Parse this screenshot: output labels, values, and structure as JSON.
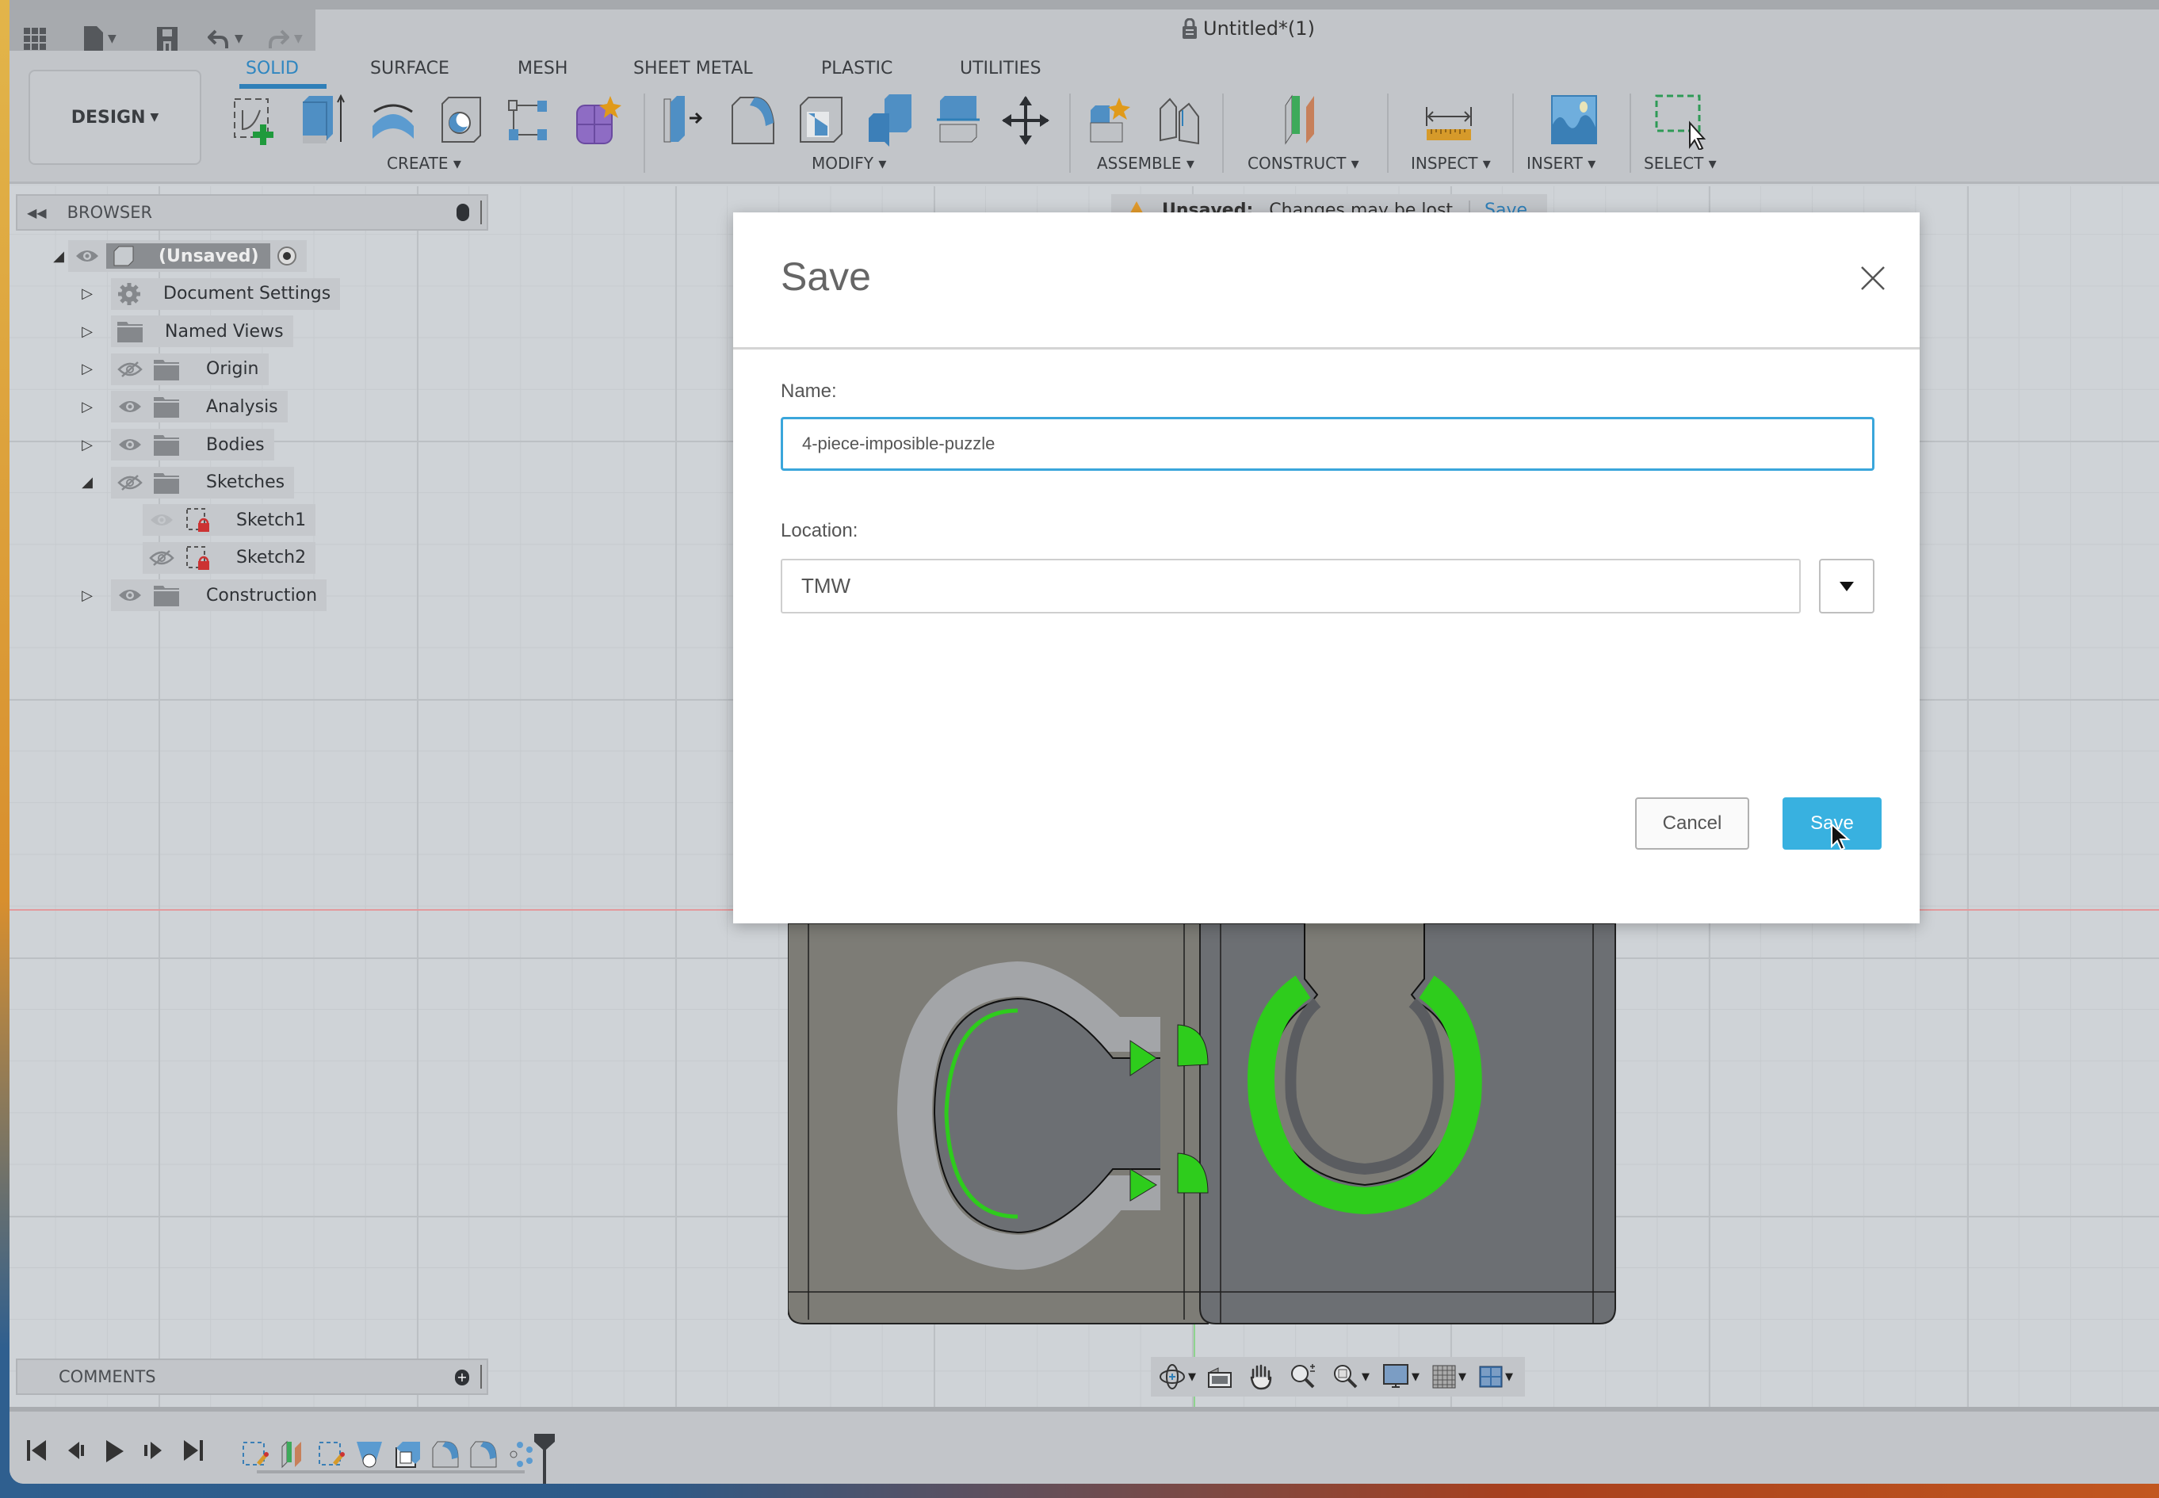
{
  "window": {
    "title": "Untitled*(1)",
    "title_icon": "lock-icon"
  },
  "quick_access": [
    {
      "name": "apps-grid-icon"
    },
    {
      "name": "file-icon",
      "has_caret": true
    },
    {
      "name": "save-icon"
    },
    {
      "name": "undo-icon",
      "has_caret": true
    },
    {
      "name": "redo-icon",
      "has_caret": true
    }
  ],
  "workspace": {
    "label": "DESIGN",
    "caret": "▾"
  },
  "tabs": [
    {
      "label": "SOLID",
      "active": true
    },
    {
      "label": "SURFACE",
      "active": false
    },
    {
      "label": "MESH",
      "active": false
    },
    {
      "label": "SHEET METAL",
      "active": false
    },
    {
      "label": "PLASTIC",
      "active": false
    },
    {
      "label": "UTILITIES",
      "active": false
    }
  ],
  "toolbar_groups": [
    {
      "label": "CREATE ▾",
      "tools": [
        "create-sketch-icon",
        "extrude-icon",
        "revolve-icon",
        "hole-icon",
        "pattern-icon",
        "create-form-icon"
      ]
    },
    {
      "label": "MODIFY ▾",
      "tools": [
        "press-pull-icon",
        "fillet-icon",
        "shell-icon",
        "combine-icon",
        "split-body-icon",
        "move-icon"
      ]
    },
    {
      "label": "ASSEMBLE ▾",
      "tools": [
        "new-component-icon",
        "joint-icon"
      ]
    },
    {
      "label": "CONSTRUCT ▾",
      "tools": [
        "offset-plane-icon"
      ]
    },
    {
      "label": "INSPECT ▾",
      "tools": [
        "measure-icon"
      ]
    },
    {
      "label": "INSERT ▾",
      "tools": [
        "insert-image-icon"
      ]
    },
    {
      "label": "SELECT ▾",
      "tools": [
        "select-window-icon"
      ]
    }
  ],
  "browser": {
    "title": "BROWSER",
    "root": {
      "label": "(Unsaved)",
      "expanded": true,
      "visible": true
    },
    "items": [
      {
        "label": "Document Settings",
        "icon": "gear-icon",
        "expanded": false,
        "eye": null,
        "level": 1
      },
      {
        "label": "Named Views",
        "icon": "folder-icon",
        "expanded": false,
        "eye": null,
        "level": 1
      },
      {
        "label": "Origin",
        "icon": "folder-icon",
        "expanded": false,
        "eye": "hidden",
        "level": 1
      },
      {
        "label": "Analysis",
        "icon": "folder-icon",
        "expanded": false,
        "eye": "visible",
        "level": 1
      },
      {
        "label": "Bodies",
        "icon": "folder-icon",
        "expanded": false,
        "eye": "visible",
        "level": 1
      },
      {
        "label": "Sketches",
        "icon": "folder-icon",
        "expanded": true,
        "eye": "hidden",
        "level": 1
      },
      {
        "label": "Sketch1",
        "icon": "sketch-icon",
        "expanded": null,
        "eye": "faded",
        "level": 2
      },
      {
        "label": "Sketch2",
        "icon": "sketch-icon",
        "expanded": null,
        "eye": "hidden",
        "level": 2
      },
      {
        "label": "Construction",
        "icon": "folder-icon",
        "expanded": false,
        "eye": "visible",
        "level": 1
      }
    ]
  },
  "banner": {
    "label": "Unsaved:",
    "message": "Changes may be lost",
    "action": "Save"
  },
  "dialog": {
    "title": "Save",
    "name_label": "Name:",
    "name_value": "4-piece-imposible-puzzle",
    "location_label": "Location:",
    "location_value": "TMW",
    "cancel_label": "Cancel",
    "save_label": "Save"
  },
  "comments": {
    "title": "COMMENTS"
  },
  "nav_bar": [
    {
      "name": "orbit-icon",
      "caret": true
    },
    {
      "name": "look-at-icon",
      "caret": false
    },
    {
      "name": "pan-icon",
      "caret": false
    },
    {
      "name": "zoom-icon",
      "caret": false
    },
    {
      "name": "fit-icon",
      "caret": true
    },
    {
      "name": "display-settings-icon",
      "caret": true
    },
    {
      "name": "grid-settings-icon",
      "caret": true
    },
    {
      "name": "viewports-icon",
      "caret": true
    }
  ],
  "timeline": {
    "controls": [
      "go-to-start-icon",
      "step-back-icon",
      "play-icon",
      "step-forward-icon",
      "go-to-end-icon"
    ],
    "features": [
      "sketch-feature-icon",
      "plane-feature-icon",
      "sketch-feature-icon",
      "revolve-feature-icon",
      "shell-feature-icon",
      "fillet-feature-icon",
      "fillet-feature-icon",
      "pattern-feature-icon"
    ]
  },
  "colors": {
    "accent": "#38b1e0",
    "tab_active": "#2f86c0",
    "highlight_green": "#2ecc1c"
  }
}
